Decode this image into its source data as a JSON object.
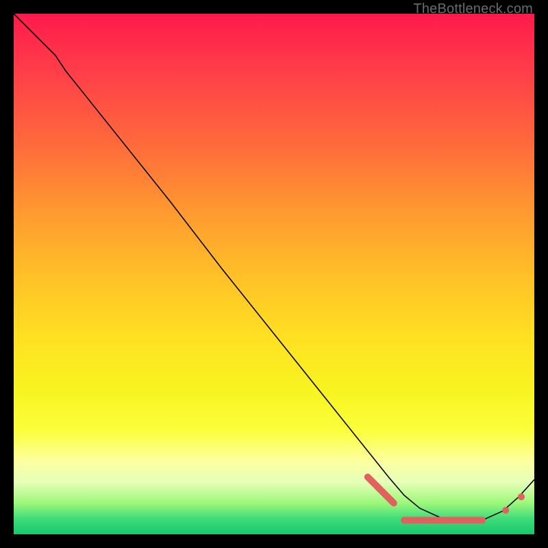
{
  "attribution": "TheBottleneck.com",
  "colors": {
    "gradient_top": "#ff1a4a",
    "gradient_mid1": "#ff9930",
    "gradient_mid2": "#ffe022",
    "gradient_bottom": "#18c76a",
    "curve": "#000000",
    "marker": "#e0625e",
    "background": "#000000"
  },
  "chart_data": {
    "type": "line",
    "title": "",
    "xlabel": "",
    "ylabel": "",
    "xlim": [
      0,
      100
    ],
    "ylim": [
      0,
      100
    ],
    "grid": false,
    "legend": false,
    "series": [
      {
        "name": "curve",
        "x": [
          0,
          8,
          10,
          20,
          30,
          40,
          50,
          60,
          68,
          72,
          75,
          78,
          82,
          86,
          90,
          94,
          97,
          100
        ],
        "values": [
          100,
          92,
          89,
          76.5,
          64,
          51,
          38.5,
          26,
          16,
          11,
          7.5,
          5,
          3.2,
          2.7,
          2.7,
          4.5,
          7.2,
          10.5
        ]
      }
    ],
    "markers": {
      "cluster_a": {
        "x_range": [
          68,
          73
        ],
        "y": 3.4
      },
      "cluster_b": {
        "x_range": [
          75,
          90
        ],
        "y": 2.7
      },
      "singles": [
        {
          "x": 94.5,
          "y": 4.6
        },
        {
          "x": 97.5,
          "y": 7.2
        }
      ]
    }
  }
}
